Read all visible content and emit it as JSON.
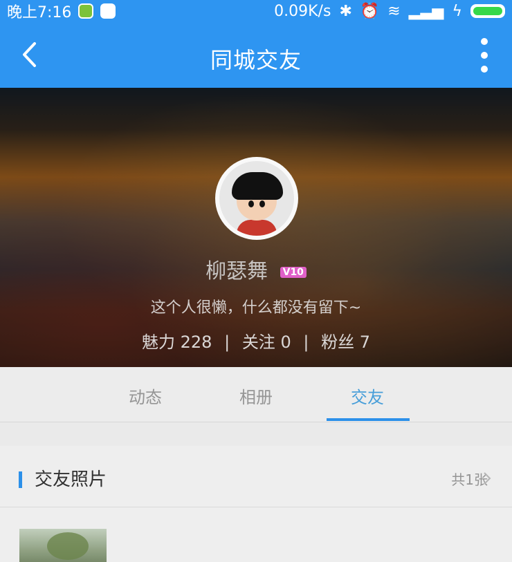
{
  "status_bar": {
    "time": "晚上7:16",
    "network_speed": "0.09K/s",
    "icons": [
      "app-green-icon",
      "app-white-icon",
      "bluetooth-icon",
      "alarm-icon",
      "wifi-icon",
      "signal-icon",
      "charging-icon",
      "battery-icon"
    ]
  },
  "header": {
    "title": "同城交友",
    "back_icon": "chevron-left-icon",
    "more_icon": "more-vertical-icon"
  },
  "profile": {
    "name": "柳瑟舞",
    "vip_badge": "V10",
    "signature": "这个人很懒，什么都没有留下~",
    "charm_label": "魅力 228",
    "follow_label": "关注 0",
    "fans_label": "粉丝 7",
    "separator": "|"
  },
  "tabs": [
    {
      "label": "动态",
      "active": false
    },
    {
      "label": "相册",
      "active": false
    },
    {
      "label": "交友",
      "active": true
    }
  ],
  "section": {
    "title": "交友照片",
    "count": "共1张"
  },
  "colors": {
    "primary": "#2e95f1",
    "active_tab": "#4aa4e0",
    "badge": "#e060c8"
  }
}
